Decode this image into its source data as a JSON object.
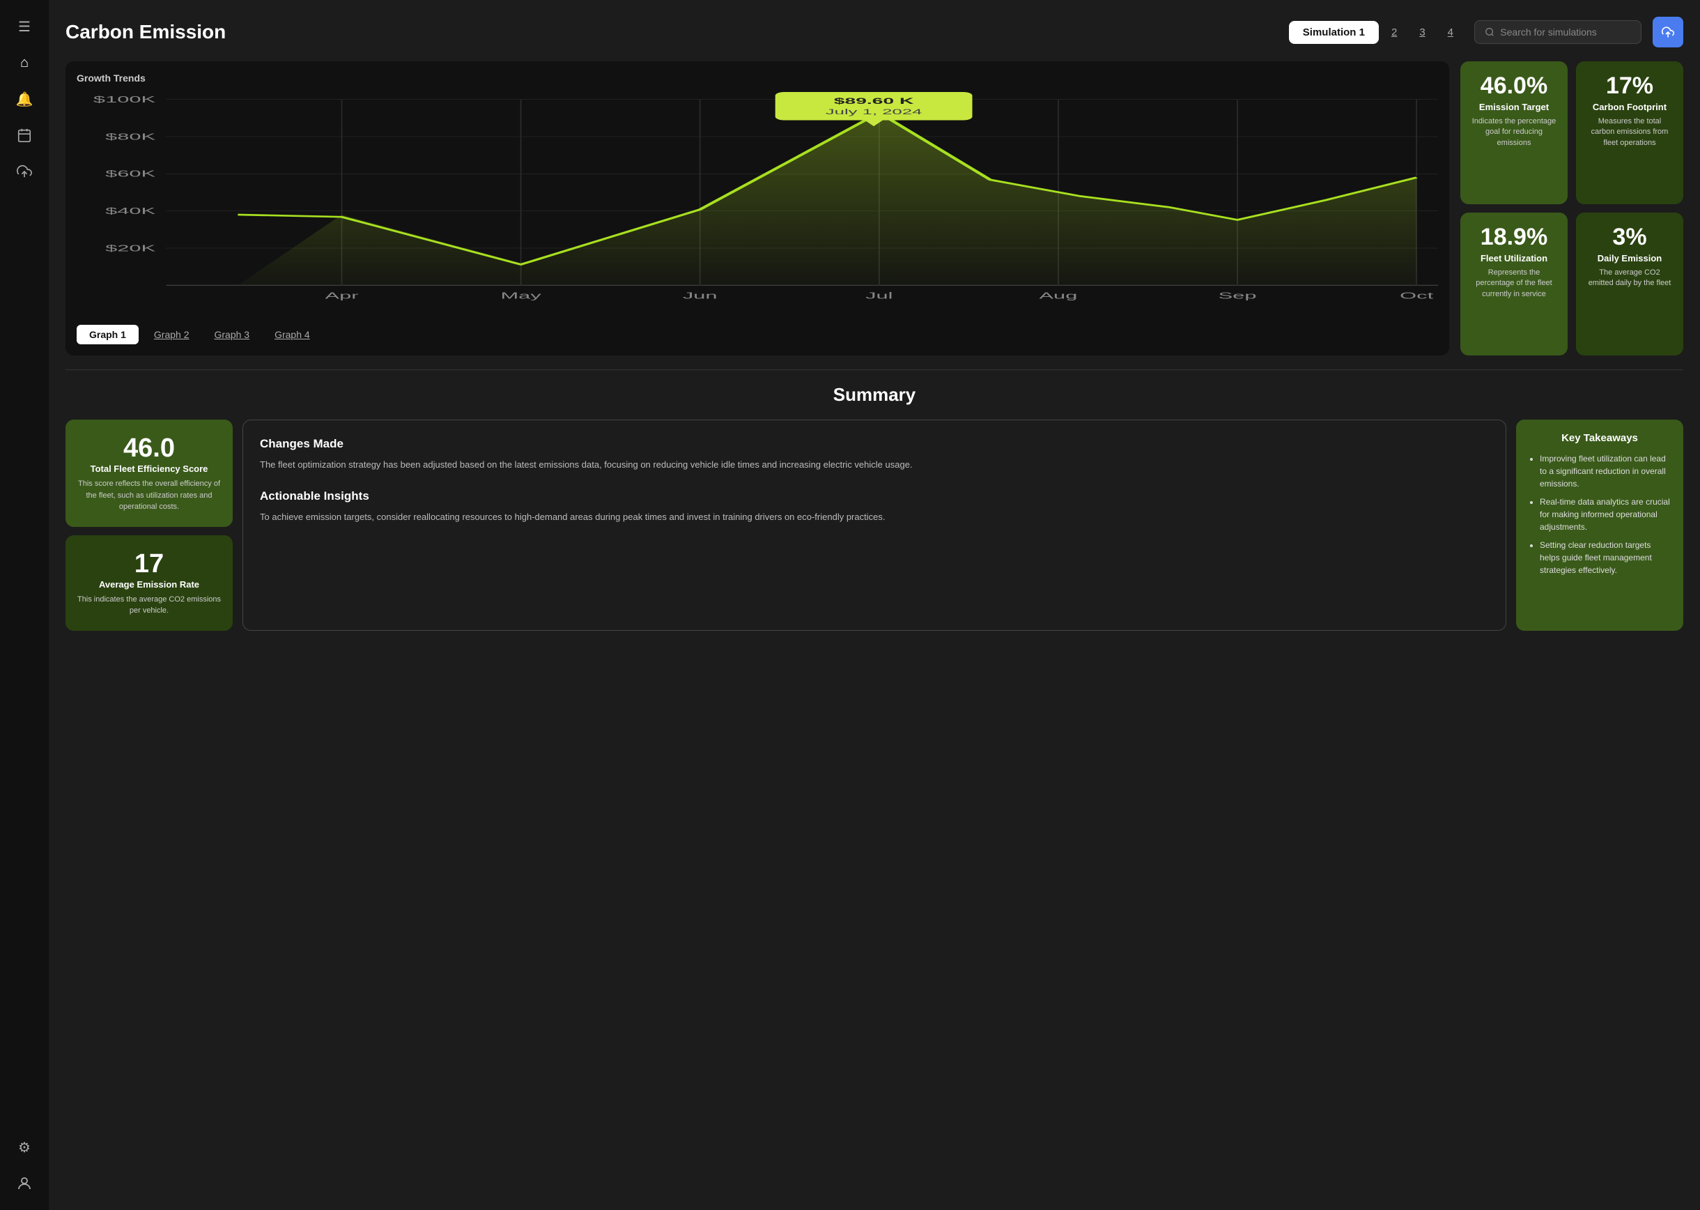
{
  "page": {
    "title": "Carbon Emission"
  },
  "sidebar": {
    "icons": [
      {
        "name": "menu-icon",
        "symbol": "☰"
      },
      {
        "name": "home-icon",
        "symbol": "⌂"
      },
      {
        "name": "bell-icon",
        "symbol": "🔔"
      },
      {
        "name": "calendar-icon",
        "symbol": "📅"
      },
      {
        "name": "upload-icon",
        "symbol": "☁"
      },
      {
        "name": "settings-icon",
        "symbol": "⚙"
      },
      {
        "name": "user-icon",
        "symbol": "👤"
      }
    ]
  },
  "header": {
    "title": "Carbon Emission",
    "simulations": {
      "active": "Simulation 1",
      "tabs": [
        "2",
        "3",
        "4"
      ]
    },
    "search": {
      "placeholder": "Search for simulations"
    },
    "share_label": "↑"
  },
  "chart": {
    "title": "Growth Trends",
    "tooltip": {
      "value": "$89.60 K",
      "date": "July 1, 2024"
    },
    "y_labels": [
      "$100K",
      "$80K",
      "$60K",
      "$40K",
      "$20K"
    ],
    "x_labels": [
      "Apr",
      "May",
      "Jun",
      "Jul",
      "Aug",
      "Sep",
      "Oct"
    ]
  },
  "graph_tabs": {
    "active": "Graph 1",
    "tabs": [
      "Graph 2",
      "Graph 3",
      "Graph 4"
    ]
  },
  "metrics": [
    {
      "value": "46.0%",
      "label": "Emission Target",
      "desc": "Indicates the percentage goal for reducing emissions",
      "dark": false
    },
    {
      "value": "17%",
      "label": "Carbon Footprint",
      "desc": "Measures the total carbon emissions from fleet operations",
      "dark": true
    },
    {
      "value": "18.9%",
      "label": "Fleet Utilization",
      "desc": "Represents the percentage of the fleet currently in service",
      "dark": false
    },
    {
      "value": "3%",
      "label": "Daily Emission",
      "desc": "The average CO2 emitted daily by the fleet",
      "dark": true
    }
  ],
  "summary": {
    "title": "Summary",
    "stats": [
      {
        "value": "46.0",
        "label": "Total Fleet Efficiency Score",
        "desc": "This score reflects the overall efficiency of the fleet, such as utilization rates and operational costs.",
        "dark": false
      },
      {
        "value": "17",
        "label": "Average Emission Rate",
        "desc": "This indicates the average CO2 emissions per vehicle.",
        "dark": true
      }
    ],
    "changes": {
      "title": "Changes Made",
      "text": "The fleet optimization strategy has been adjusted based on the latest emissions data, focusing on reducing vehicle idle times and increasing electric vehicle usage."
    },
    "insights": {
      "title": "Actionable Insights",
      "text": "To achieve emission targets, consider reallocating resources to high-demand areas during peak times and invest in training drivers on eco-friendly practices."
    },
    "takeaways": {
      "title": "Key Takeaways",
      "items": [
        "Improving fleet utilization can lead to a significant reduction in overall emissions.",
        "Real-time data analytics are crucial for making informed operational adjustments.",
        "Setting clear reduction targets helps guide fleet management strategies effectively."
      ]
    }
  }
}
